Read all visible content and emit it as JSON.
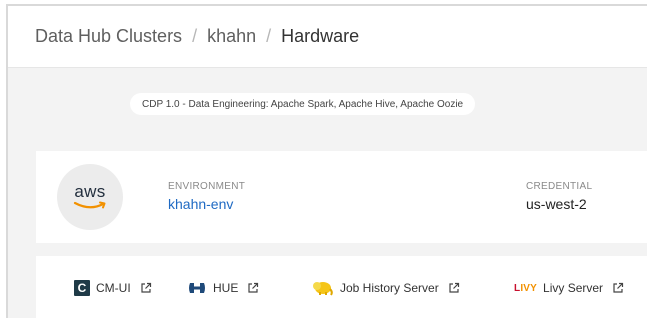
{
  "breadcrumb": {
    "items": [
      "Data Hub Clusters",
      "khahn",
      "Hardware"
    ],
    "separator": "/"
  },
  "cluster_template": "CDP 1.0 - Data Engineering: Apache Spark, Apache Hive, Apache Oozie",
  "environment": {
    "provider_logo_text": "aws",
    "label": "ENVIRONMENT",
    "value": "khahn-env",
    "credential_label": "CREDENTIAL",
    "credential_value": "us-west-2"
  },
  "links": [
    {
      "label": "CM-UI",
      "icon": "cloudera-manager-icon"
    },
    {
      "label": "HUE",
      "icon": "hue-icon"
    },
    {
      "label": "Job History Server",
      "icon": "hadoop-elephant-icon"
    },
    {
      "label": "Livy Server",
      "icon": "livy-icon",
      "icon_text": "LIVY"
    }
  ],
  "colors": {
    "link_blue": "#1f6ac3",
    "background": "#f3f3f3",
    "aws_orange": "#f29100"
  }
}
